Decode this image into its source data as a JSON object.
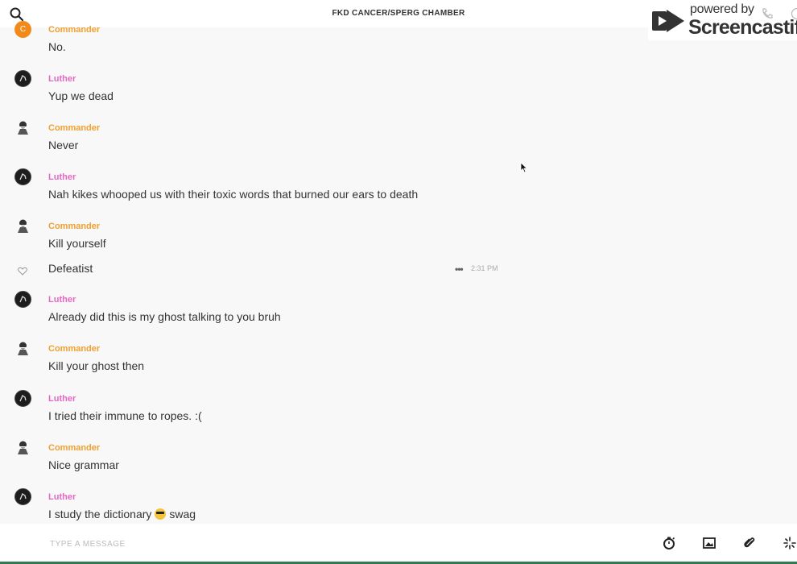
{
  "header": {
    "title": "FKD CANCER/SPERG CHAMBER"
  },
  "watermark": {
    "powered": "powered by",
    "brand": "Screencastify"
  },
  "messages": [
    {
      "author": "Commander",
      "avatar_letter": "C",
      "text": "No."
    },
    {
      "author": "Luther",
      "text": "Yup we dead"
    },
    {
      "author": "Commander",
      "text": "Never"
    },
    {
      "author": "Luther",
      "text": "Nah kikes whooped us with their toxic words that burned our ears to death"
    },
    {
      "author": "Commander",
      "text": "Kill yourself"
    },
    {
      "text": "Defeatist",
      "more": "•••",
      "time": "2:31 PM"
    },
    {
      "author": "Luther",
      "text": "Already did this is my ghost talking to you bruh"
    },
    {
      "author": "Commander",
      "text": "Kill your ghost then"
    },
    {
      "author": "Luther",
      "text": "I tried their immune to ropes. :("
    },
    {
      "author": "Commander",
      "text": "Nice grammar"
    },
    {
      "author": "Luther",
      "text_before": "I study the dictionary",
      "text_after": "swag"
    }
  ],
  "composer": {
    "placeholder": "TYPE A MESSAGE"
  },
  "icons": {
    "search": "search-icon",
    "timer": "timer-icon",
    "image": "image-icon",
    "attach": "paperclip-icon",
    "giphy": "sparkle-icon",
    "phone": "phone-icon",
    "info": "info-icon",
    "like": "heart-icon",
    "emoji": "sunglasses-emoji"
  },
  "colors": {
    "commander": "#f0a030",
    "luther": "#e467c4",
    "avatar_c": "#f28a1a",
    "background": "#f8f8f9"
  }
}
